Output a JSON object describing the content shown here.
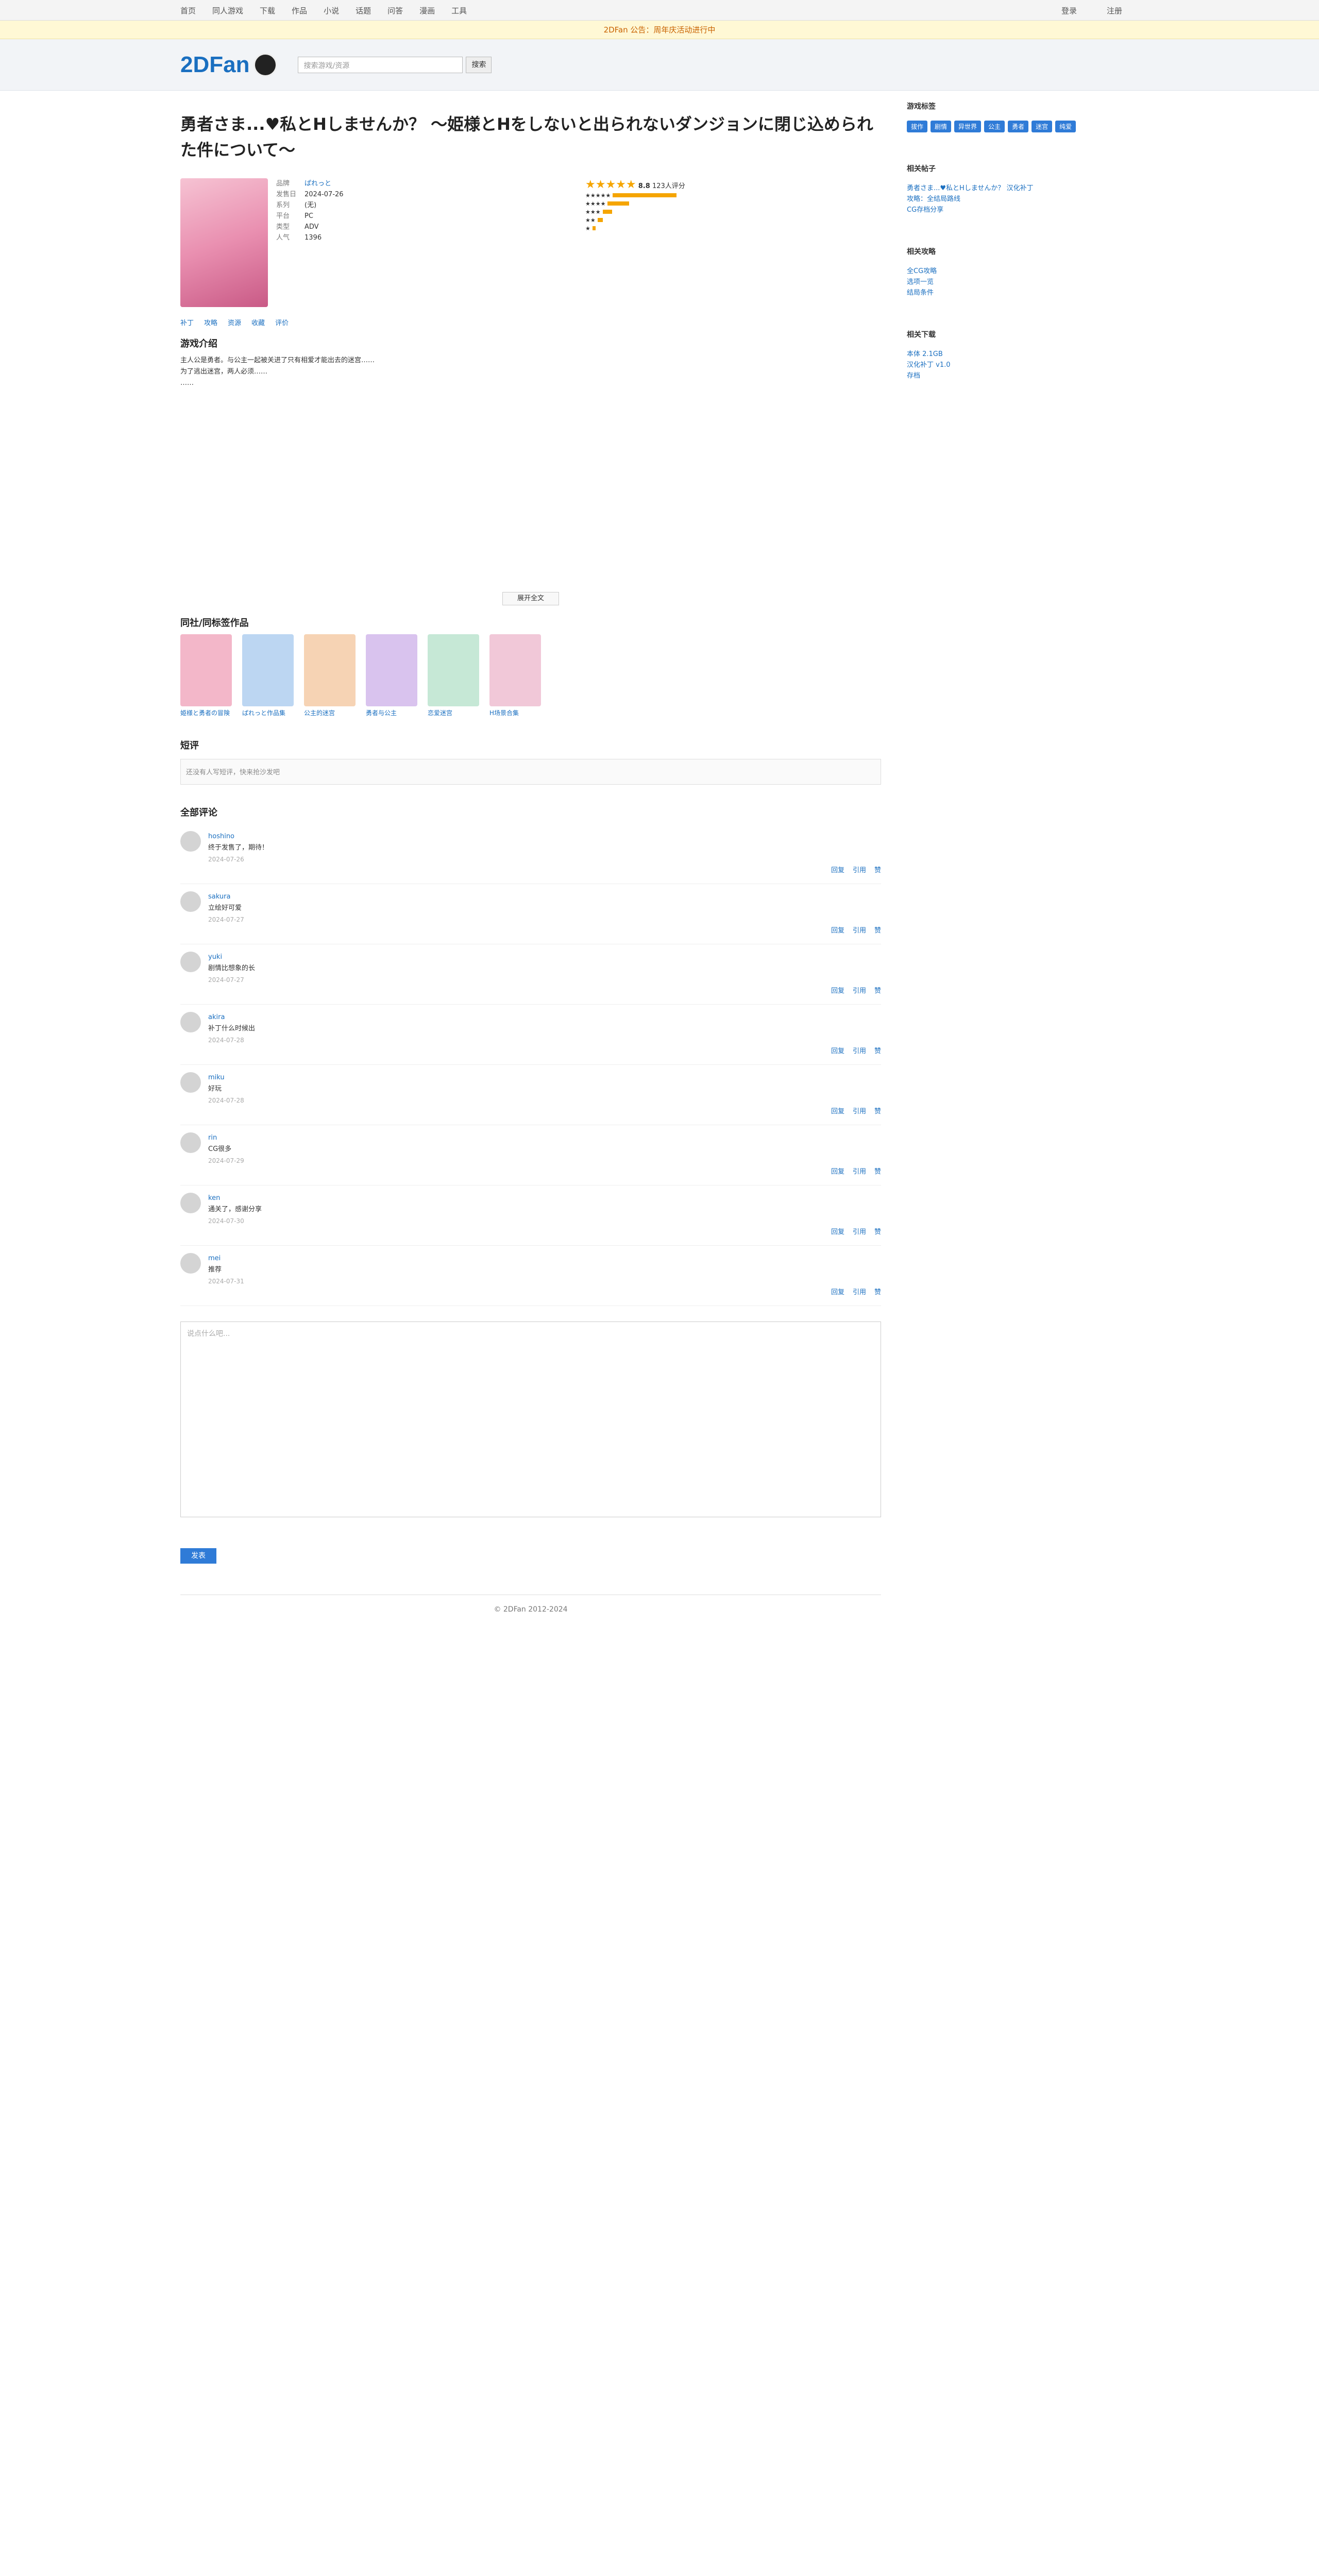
{
  "nav": {
    "items": [
      "首页",
      "同人游戏",
      "下载",
      "作品",
      "小说",
      "话题",
      "问答",
      "漫画",
      "工具"
    ],
    "right": [
      "登录",
      "注册"
    ]
  },
  "notice": "2DFan 公告：周年庆活动进行中",
  "header": {
    "logo": "2DFan",
    "search_placeholder": "搜索游戏/资源",
    "search_btn": "搜索"
  },
  "game": {
    "title": "勇者さま...♥私とHしませんか？ ～姫様とHをしないと出られないダンジョンに閉じ込められた件について～",
    "meta": [
      [
        "品牌",
        "ぱれっと"
      ],
      [
        "发售日",
        "2024-07-26"
      ],
      [
        "系列",
        "(无)"
      ],
      [
        "平台",
        "PC"
      ],
      [
        "类型",
        "ADV"
      ],
      [
        "人气",
        "1396"
      ]
    ],
    "score": "8.8",
    "rating_count": "123人评分",
    "rating_bars": [
      0.62,
      0.21,
      0.09,
      0.05,
      0.03
    ],
    "tags": [
      "补丁",
      "攻略",
      "资源",
      "收藏",
      "评价"
    ],
    "desc_title": "游戏介绍",
    "description": "主人公是勇者。与公主一起被关进了只有相爱才能出去的迷宫……\n为了逃出迷宫，两人必须……\n……",
    "more": "展开全文"
  },
  "related_title": "同社/同标签作品",
  "related": [
    "姫様と勇者の冒険",
    "ぱれっと作品集",
    "公主的迷宫",
    "勇者与公主",
    "恋爱迷宫",
    "H场景合集"
  ],
  "short_title": "短评",
  "short_placeholder": "还没有人写短评，快来抢沙发吧",
  "comments_title": "全部评论",
  "comments": [
    {
      "name": "hoshino",
      "date": "2024-07-26",
      "text": "终于发售了，期待！"
    },
    {
      "name": "sakura",
      "date": "2024-07-27",
      "text": "立绘好可爱"
    },
    {
      "name": "yuki",
      "date": "2024-07-27",
      "text": "剧情比想象的长"
    },
    {
      "name": "akira",
      "date": "2024-07-28",
      "text": "补丁什么时候出"
    },
    {
      "name": "miku",
      "date": "2024-07-28",
      "text": "好玩"
    },
    {
      "name": "rin",
      "date": "2024-07-29",
      "text": "CG很多"
    },
    {
      "name": "ken",
      "date": "2024-07-30",
      "text": "通关了，感谢分享"
    },
    {
      "name": "mei",
      "date": "2024-07-31",
      "text": "推荐"
    }
  ],
  "reply_btn": "回复",
  "quote_btn": "引用",
  "like_btn": "赞",
  "editor_placeholder": "说点什么吧...",
  "submit": "发表",
  "footer": "© 2DFan 2012-2024",
  "sidebar": {
    "tags_title": "游戏标签",
    "tags": [
      "拔作",
      "剧情",
      "异世界",
      "公主",
      "勇者",
      "迷宫",
      "纯爱"
    ],
    "p1_title": "相关帖子",
    "p1": [
      "勇者さま...♥私とHしませんか？ 汉化补丁",
      "攻略：全结局路线",
      "CG存档分享"
    ],
    "p2_title": "相关攻略",
    "p2": [
      "全CG攻略",
      "选项一览",
      "结局条件"
    ],
    "p3_title": "相关下载",
    "p3": [
      "本体 2.1GB",
      "汉化补丁 v1.0",
      "存档"
    ]
  }
}
